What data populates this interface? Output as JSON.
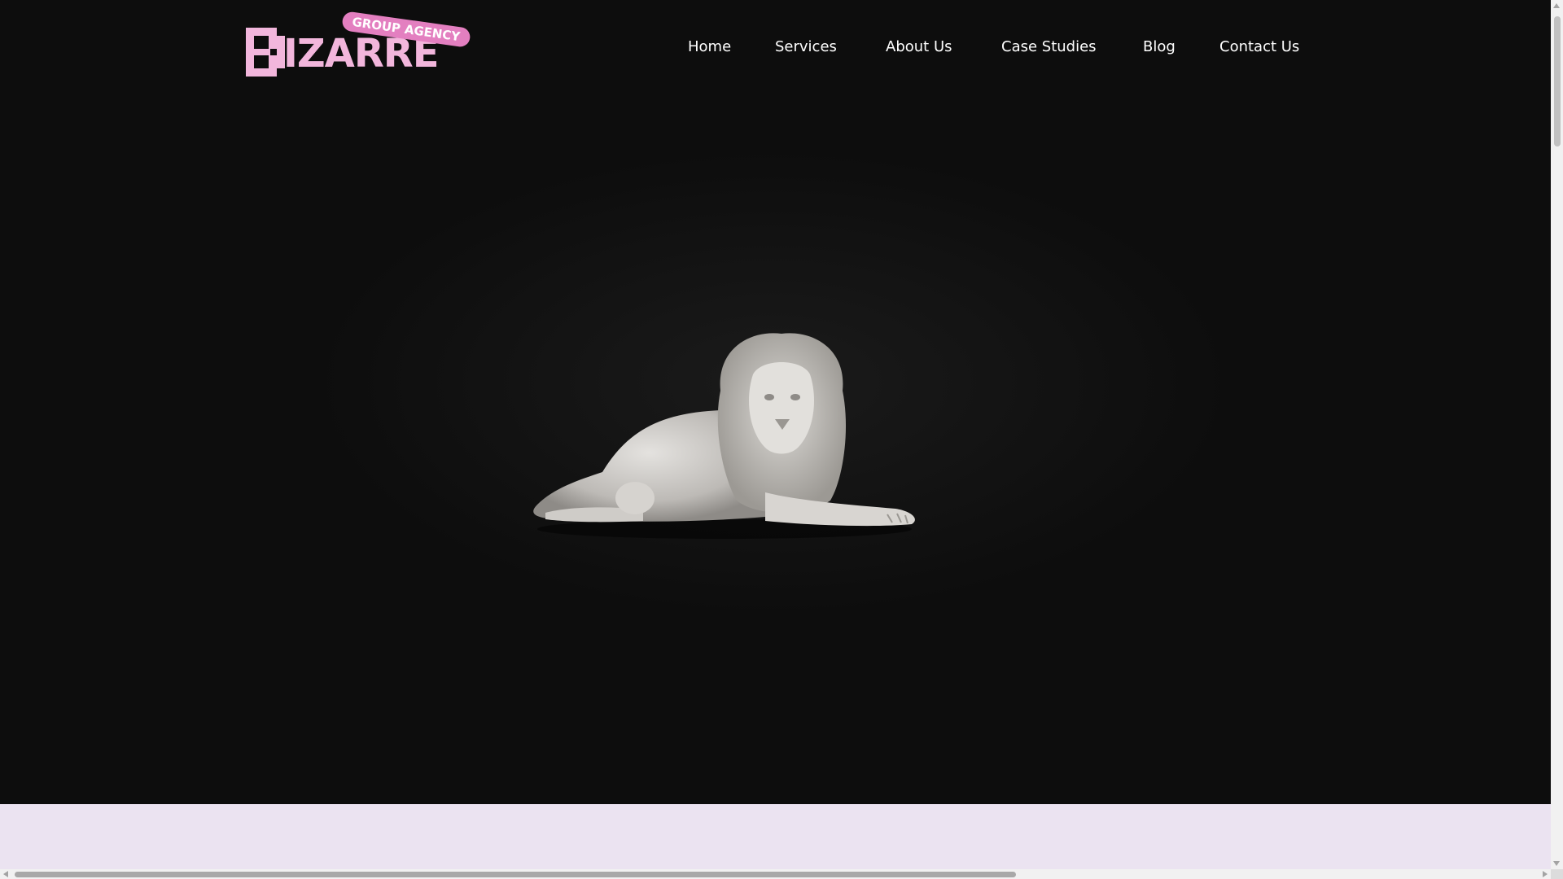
{
  "brand": {
    "name": "IZARRE",
    "tagline": "GROUP AGENCY",
    "accent_color": "#f2b6dc",
    "tag_color": "#e37fc0"
  },
  "nav": {
    "items": [
      {
        "label": "Home"
      },
      {
        "label": "Services"
      },
      {
        "label": "About Us"
      },
      {
        "label": "Case Studies"
      },
      {
        "label": "Blog"
      },
      {
        "label": "Contact Us"
      }
    ]
  },
  "hero": {
    "image_icon": "lion-statue-image",
    "background_color": "#0d0d0d"
  },
  "section_band": {
    "background_color": "#ebe3f1"
  }
}
